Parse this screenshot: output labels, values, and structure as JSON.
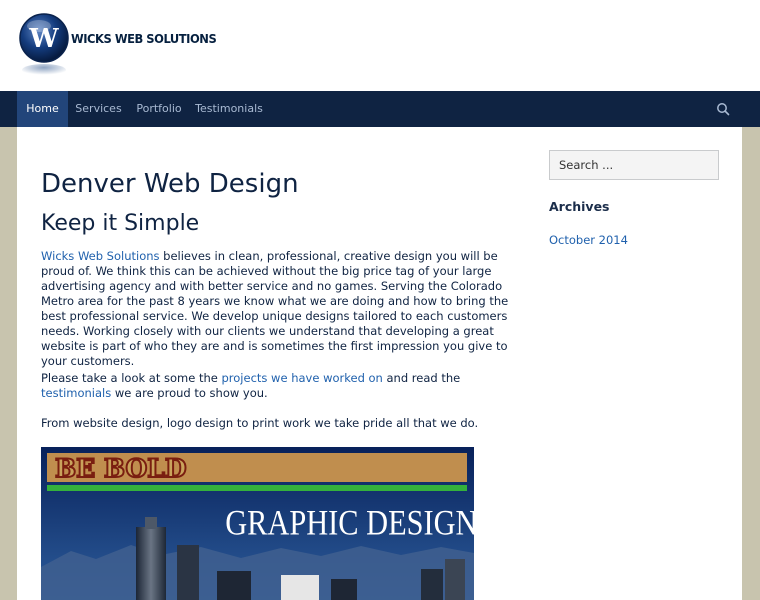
{
  "site": {
    "logo_text": "WICKS WEB SOLUTIONS",
    "logo_letter": "W"
  },
  "nav": {
    "items": [
      {
        "label": "Home",
        "active": true
      },
      {
        "label": "Services",
        "active": false
      },
      {
        "label": "Portfolio",
        "active": false
      },
      {
        "label": "Testimonials",
        "active": false
      }
    ],
    "search_icon": "search-icon"
  },
  "content": {
    "title": "Denver Web Design",
    "subtitle": "Keep it Simple",
    "p1_link": "Wicks Web Solutions",
    "p1_text": " believes in clean, professional, creative design you will be proud of. We think this can be achieved without the big price tag of your large advertising agency and with better service and no games. Serving the Colorado Metro area for the past 8 years we know what we are doing and how to bring the best professional service. We develop unique designs tailored to each customers needs. Working closely with our clients we understand that developing a great website is part of who they are and is sometimes the first impression you give to your customers.",
    "p2_a": "Please take a look at some the ",
    "p2_link1": "projects we have worked on",
    "p2_b": " and read the ",
    "p2_link2": "testimonials",
    "p2_c": " we are proud to show you.",
    "p3": "From website design, logo design to print work we take pride all that we do.",
    "banner": {
      "headline": "BE BOLD",
      "caption": "GRAPHIC DESIGN"
    }
  },
  "sidebar": {
    "search_placeholder": "Search ...",
    "archives_title": "Archives",
    "archive_links": [
      "October 2014"
    ]
  },
  "colors": {
    "page_bg": "#c8c4ae",
    "nav_bg": "#0f2342",
    "nav_active": "#22457a",
    "link": "#2061ad",
    "text": "#0f2342"
  }
}
